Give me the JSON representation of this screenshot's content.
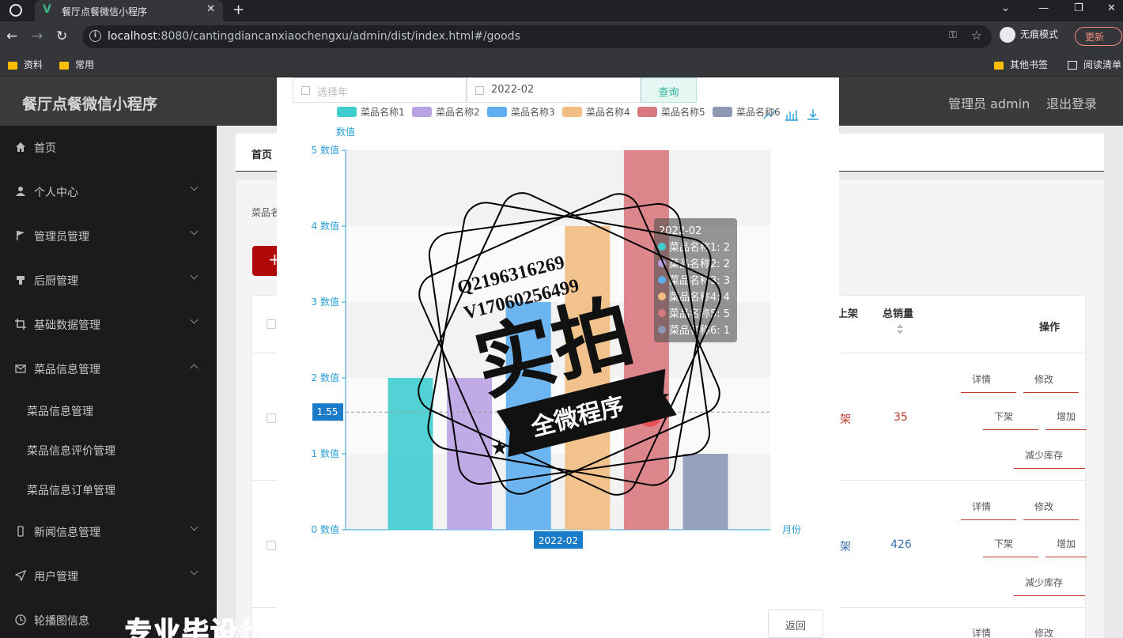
{
  "browser": {
    "tab_title": "餐厅点餐微信小程序",
    "tab_close": "✕",
    "new_tab": "+",
    "url_host": "localhost",
    "url_rest": ":8080/cantingdiancanxiaochengxu/admin/dist/index.html#/goods",
    "incognito_label": "无痕模式",
    "update_label": "更新",
    "bookmarks": [
      "资料",
      "常用",
      "其他书签",
      "阅读清单"
    ]
  },
  "header": {
    "brand": "餐厅点餐微信小程序",
    "admin": "管理员 admin",
    "logout": "退出登录"
  },
  "sidebar": {
    "items": [
      {
        "label": "首页",
        "icon": "home-icon"
      },
      {
        "label": "个人中心",
        "icon": "user-icon"
      },
      {
        "label": "管理员管理",
        "icon": "flag-icon"
      },
      {
        "label": "后厨管理",
        "icon": "kitchen-icon"
      },
      {
        "label": "基础数据管理",
        "icon": "crop-icon"
      },
      {
        "label": "菜品信息管理",
        "icon": "mail-icon"
      },
      {
        "label": "新闻信息管理",
        "icon": "phone-icon"
      },
      {
        "label": "用户管理",
        "icon": "send-icon"
      },
      {
        "label": "轮播图信息",
        "icon": "clock-icon"
      }
    ],
    "sub_items": [
      "菜品信息管理",
      "菜品信息评价管理",
      "菜品信息订单管理"
    ]
  },
  "page": {
    "breadcrumb": "首页",
    "search_label": "菜品名",
    "add_label": "+",
    "table": {
      "headers": [
        "上架",
        "总销量",
        "操作"
      ],
      "rows": [
        {
          "status": "架",
          "sales": "35"
        },
        {
          "status": "架",
          "sales": "426"
        }
      ],
      "actions": {
        "detail": "详情",
        "edit": "修改",
        "offline": "下架",
        "increase": "增加",
        "decrease": "减少库存"
      }
    }
  },
  "modal": {
    "year_placeholder": "选择年",
    "month_value": "2022-02",
    "query_label": "查询",
    "back_label": "返回"
  },
  "chart_data": {
    "type": "bar",
    "categories": [
      "2022-02"
    ],
    "series": [
      {
        "name": "菜品名称1",
        "values": [
          2
        ],
        "color": "#3fcdd0"
      },
      {
        "name": "菜品名称2",
        "values": [
          2
        ],
        "color": "#b9a2e3"
      },
      {
        "name": "菜品名称3",
        "values": [
          3
        ],
        "color": "#5eaef0"
      },
      {
        "name": "菜品名称4",
        "values": [
          4
        ],
        "color": "#f2bd82"
      },
      {
        "name": "菜品名称5",
        "values": [
          5
        ],
        "color": "#d97a80"
      },
      {
        "name": "菜品名称6",
        "values": [
          1
        ],
        "color": "#8e98b5"
      }
    ],
    "ylabel": "数值",
    "xlabel": "月份",
    "ylim": [
      0,
      5
    ],
    "yticks": [
      "0 数值",
      "1 数值",
      "2 数值",
      "3 数值",
      "4 数值",
      "5 数值"
    ],
    "pointer_value": "1.55",
    "pointer_category": "2022-02",
    "tooltip": {
      "title": "2022-02",
      "lines": [
        "菜品名称1: 2",
        "菜品名称2: 2",
        "菜品名称3: 3",
        "菜品名称4: 4",
        "菜品名称5: 5",
        "菜品名称6: 1"
      ]
    },
    "legend_position": "top",
    "grid": true
  },
  "watermark": {
    "contact1": "Q2196316269",
    "contact2": "V17060256499",
    "big": "实拍",
    "ribbon": "全微程序",
    "bottom": "专业毕设代做"
  }
}
